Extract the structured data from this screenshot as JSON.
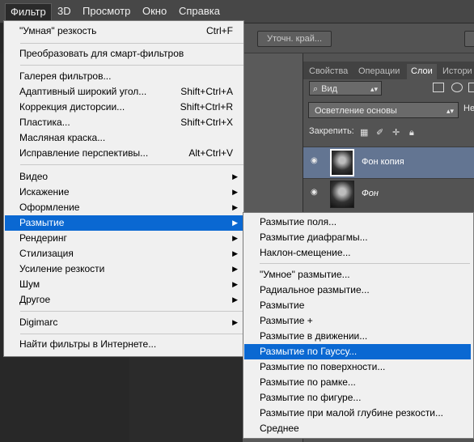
{
  "menubar": {
    "items": [
      "Фильтр",
      "3D",
      "Просмотр",
      "Окно",
      "Справка"
    ]
  },
  "options_bar": {
    "refine_edge_label": "Уточн. край..."
  },
  "panels": {
    "tabs": [
      "Свойства",
      "Операции",
      "Слои",
      "Истори"
    ],
    "active_tab": "Слои",
    "kind_filter": "Вид",
    "blend_mode": "Осветление основы",
    "opacity_label_partial": "Не",
    "lock_label": "Закрепить:",
    "layers": [
      {
        "name": "Фон копия",
        "selected": true
      },
      {
        "name": "Фон",
        "selected": false
      }
    ]
  },
  "filter_menu": {
    "items": [
      {
        "label": "\"Умная\" резкость",
        "shortcut": "Ctrl+F"
      },
      {
        "label": "Преобразовать для смарт-фильтров"
      },
      {
        "label": "Галерея фильтров..."
      },
      {
        "label": "Адаптивный широкий угол...",
        "shortcut": "Shift+Ctrl+A"
      },
      {
        "label": "Коррекция дисторсии...",
        "shortcut": "Shift+Ctrl+R"
      },
      {
        "label": "Пластика...",
        "shortcut": "Shift+Ctrl+X"
      },
      {
        "label": "Масляная краска..."
      },
      {
        "label": "Исправление перспективы...",
        "shortcut": "Alt+Ctrl+V"
      },
      {
        "label": "Видео",
        "submenu": true
      },
      {
        "label": "Искажение",
        "submenu": true
      },
      {
        "label": "Оформление",
        "submenu": true
      },
      {
        "label": "Размытие",
        "submenu": true,
        "highlighted": true
      },
      {
        "label": "Рендеринг",
        "submenu": true
      },
      {
        "label": "Стилизация",
        "submenu": true
      },
      {
        "label": "Усиление резкости",
        "submenu": true
      },
      {
        "label": "Шум",
        "submenu": true
      },
      {
        "label": "Другое",
        "submenu": true
      },
      {
        "label": "Digimarc",
        "submenu": true
      },
      {
        "label": "Найти фильтры в Интернете..."
      }
    ]
  },
  "blur_submenu": {
    "items": [
      {
        "label": "Размытие поля..."
      },
      {
        "label": "Размытие диафрагмы..."
      },
      {
        "label": "Наклон-смещение..."
      },
      {
        "label": "\"Умное\" размытие..."
      },
      {
        "label": "Радиальное размытие..."
      },
      {
        "label": "Размытие"
      },
      {
        "label": "Размытие +"
      },
      {
        "label": "Размытие в движении..."
      },
      {
        "label": "Размытие по Гауссу...",
        "highlighted": true
      },
      {
        "label": "Размытие по поверхности..."
      },
      {
        "label": "Размытие по рамке..."
      },
      {
        "label": "Размытие по фигуре..."
      },
      {
        "label": "Размытие при малой глубине резкости..."
      },
      {
        "label": "Среднее"
      }
    ]
  },
  "icons": {
    "submenu_arrow": "triangle-right-icon",
    "eye": "eye-icon",
    "search": "search-icon",
    "lock": "lock-icon"
  },
  "colors": {
    "highlight": "#0a68d2",
    "menu_bg": "#f0f0f0",
    "selected_layer": "#637592"
  }
}
